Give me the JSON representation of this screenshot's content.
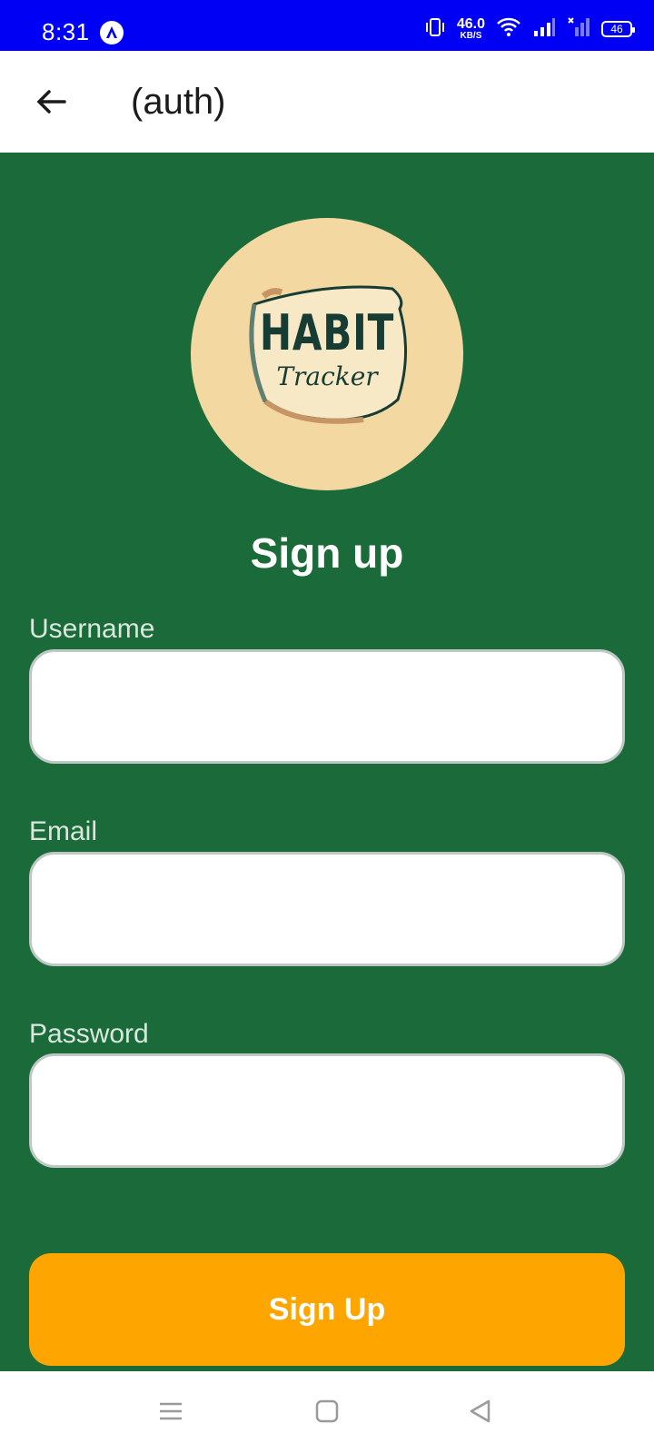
{
  "status_bar": {
    "time": "8:31",
    "net_speed_value": "46.0",
    "net_speed_unit": "KB/S",
    "battery": "46",
    "icons": [
      "app-notification-icon",
      "vibrate-icon",
      "wifi-icon",
      "signal-icon",
      "signal-off-icon",
      "battery-icon"
    ]
  },
  "app_bar": {
    "title": "(auth)",
    "back_icon": "arrow-left-icon"
  },
  "logo": {
    "main": "HABIT",
    "sub": "Tracker",
    "background_color": "#f3d8a1"
  },
  "page": {
    "title": "Sign up",
    "background_color": "#1b6a3a"
  },
  "form": {
    "username_label": "Username",
    "email_label": "Email",
    "password_label": "Password",
    "username_value": "",
    "email_value": "",
    "password_value": ""
  },
  "actions": {
    "signup_label": "Sign Up",
    "signup_color": "#ffa500"
  },
  "nav_bar": {
    "icons": [
      "menu-icon",
      "home-square-icon",
      "back-triangle-icon"
    ]
  }
}
